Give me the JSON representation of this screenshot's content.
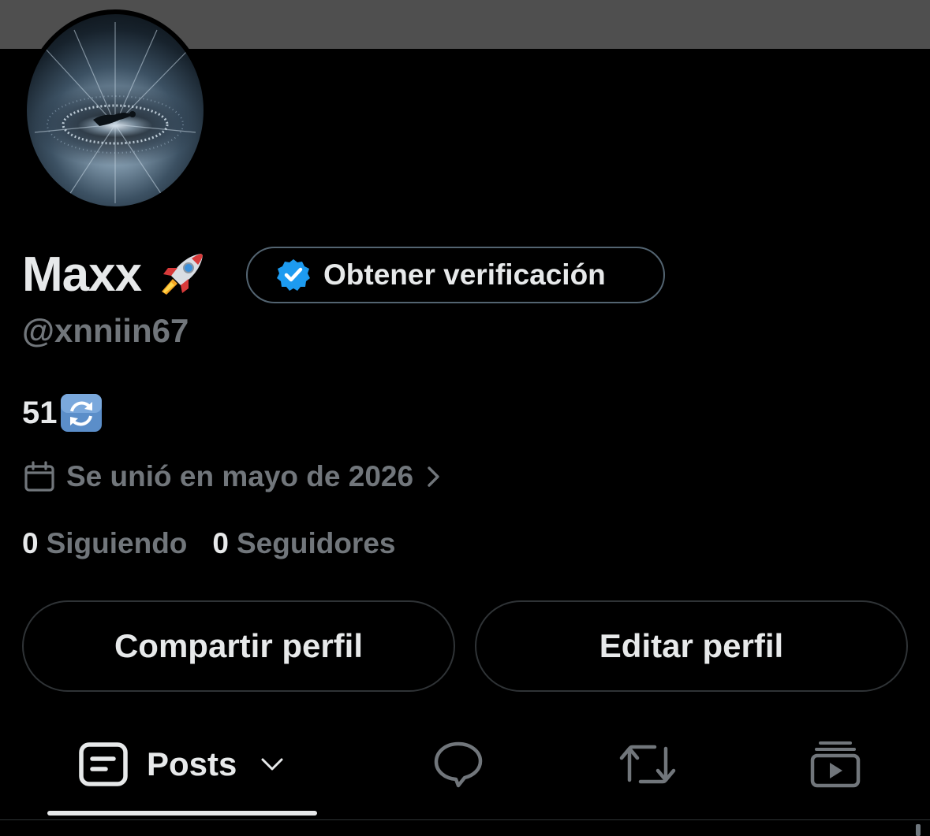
{
  "profile": {
    "display_name": "Maxx",
    "name_emoji": "rocket-emoji",
    "handle": "@xnniin67",
    "bio": "51",
    "bio_emoji": "counterclockwise-arrows-emoji",
    "joined": "Se unió en mayo de 2026",
    "following_count": "0",
    "following_label": "Siguiendo",
    "followers_count": "0",
    "followers_label": "Seguidores"
  },
  "verification": {
    "label": "Obtener verificación",
    "icon": "verified-badge-icon"
  },
  "actions": {
    "share_label": "Compartir perfil",
    "edit_label": "Editar perfil"
  },
  "tabs": {
    "posts_label": "Posts",
    "items": [
      "posts-icon",
      "replies-icon",
      "reposts-icon",
      "media-icon"
    ]
  },
  "colors": {
    "background": "#000000",
    "banner": "#4f4f4f",
    "primary_text": "#e7e9ea",
    "secondary_text": "#71767b",
    "border": "#2f3336",
    "verified_blue": "#1d9bf0"
  }
}
